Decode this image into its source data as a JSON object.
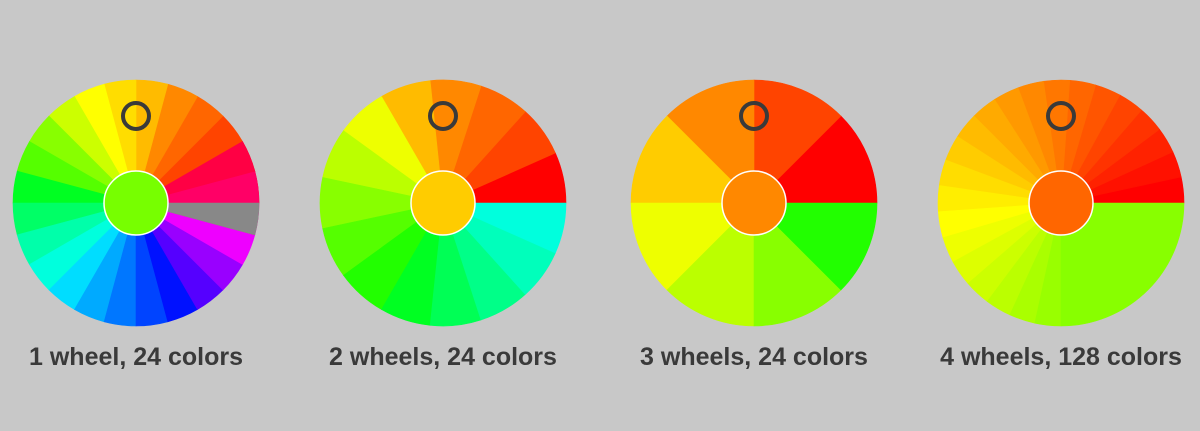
{
  "wheels": [
    {
      "caption": "1 wheel, 24 colors",
      "center_color": "#77ff00",
      "segments": [
        "#ff0000",
        "#ff2200",
        "#ff4400",
        "#ff6600",
        "#ff8800",
        "#ffbb00",
        "#ffdd00",
        "#ffff00",
        "#ccff00",
        "#88ff00",
        "#55ff00",
        "#00ff22",
        "#00ff66",
        "#00ffaa",
        "#00ffdd",
        "#00ddff",
        "#00aaff",
        "#0077ff",
        "#0044ff",
        "#0011ff",
        "#5500ff",
        "#9900ff",
        "#ee00ff",
        "#ff00aa",
        "#ff0066",
        "#ff0044",
        "#888888"
      ]
    },
    {
      "caption": "2 wheels, 24 colors",
      "center_color": "#ffcc00",
      "segments": [
        "#ff0000",
        "#ff4400",
        "#ff6600",
        "#ff8800",
        "#ffbb00",
        "#eeff00",
        "#bbff00",
        "#88ff00",
        "#55ff00",
        "#22ff00",
        "#00ff22",
        "#00ff55",
        "#00ff88",
        "#00ffbb",
        "#00ffdd"
      ]
    },
    {
      "caption": "3 wheels, 24 colors",
      "center_color": "#ff8800",
      "segments": [
        "#ff0000",
        "#ff4400",
        "#ff8800",
        "#ffcc00",
        "#eeff00",
        "#bbff00",
        "#88ff00",
        "#22ff00"
      ]
    },
    {
      "caption": "4 wheels, 128 colors",
      "center_color": "#ff6600",
      "segments": [
        "#ff0000",
        "#ff1100",
        "#ff2200",
        "#ff3300",
        "#ff4400",
        "#ff5500",
        "#ff6600",
        "#ff7700",
        "#ff8800",
        "#ff9900",
        "#ffaa00",
        "#ffbb00",
        "#ffcc00",
        "#ffdd00",
        "#ffee00",
        "#ffff00",
        "#eeff00",
        "#ddff00",
        "#ccff00",
        "#bbff00",
        "#aaff00",
        "#99ff00",
        "#88ff00"
      ]
    }
  ],
  "selector_color": "#3a3a3a",
  "center_border_color": "#ffffff"
}
